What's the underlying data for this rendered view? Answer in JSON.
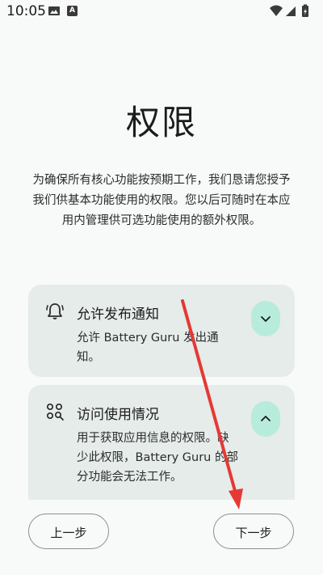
{
  "status_bar": {
    "time": "10:05",
    "icons": [
      "image-icon",
      "a-icon",
      "wifi-icon",
      "signal-icon",
      "battery-icon"
    ]
  },
  "page": {
    "title": "权限",
    "description": "为确保所有核心功能按预期工作，我们恳请您授予我们供基本功能使用的权限。您以后可随时在本应用内管理供可选功能使用的额外权限。"
  },
  "permissions": [
    {
      "icon": "bell-icon",
      "title": "允许发布通知",
      "body": "允许 Battery Guru 发出通知。",
      "expand_icon": "chevron-down-icon"
    },
    {
      "icon": "usage-icon",
      "title": "访问使用情况",
      "body": "用于获取应用信息的权限。缺少此权限，Battery Guru 的部分功能会无法工作。",
      "expand_icon": "chevron-up-icon"
    }
  ],
  "buttons": {
    "prev_label": "上一步",
    "next_label": "下一步"
  },
  "colors": {
    "background": "#f7faf8",
    "card": "#e6ece9",
    "accent": "#b7ecdc",
    "annotation_arrow": "#e53935"
  }
}
